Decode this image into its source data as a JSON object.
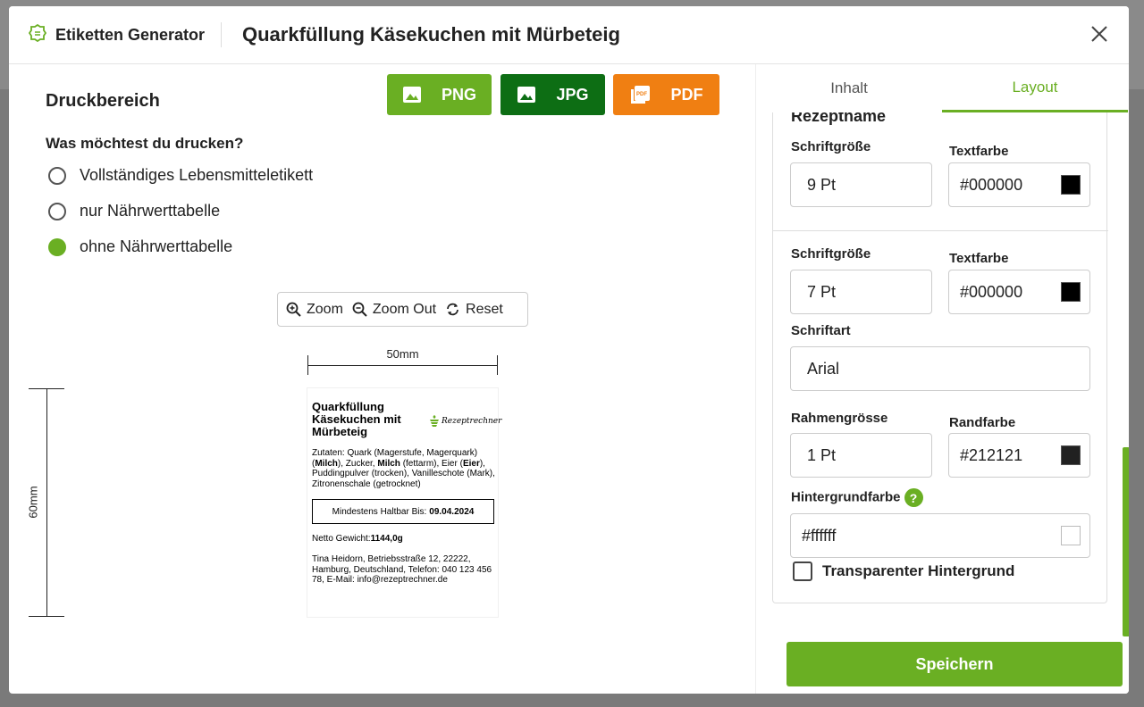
{
  "header": {
    "brand": "Etiketten Generator",
    "title": "Quarkfüllung Käsekuchen mit Mürbeteig"
  },
  "left": {
    "section_title": "Druckbereich",
    "export_buttons": {
      "png": "PNG",
      "jpg": "JPG",
      "pdf": "PDF"
    },
    "question": "Was möchtest du drucken?",
    "options": [
      {
        "label": "Vollständiges Lebensmitteletikett",
        "selected": false
      },
      {
        "label": "nur Nährwerttabelle",
        "selected": false
      },
      {
        "label": "ohne Nährwerttabelle",
        "selected": true
      }
    ],
    "zoom": {
      "zoom_in": "Zoom",
      "zoom_out": "Zoom Out",
      "reset": "Reset"
    },
    "dimensions": {
      "width": "50mm",
      "height": "60mm"
    }
  },
  "label": {
    "title": "Quarkfüllung Käsekuchen mit Mürbeteig",
    "logo_text": "Rezeptrechner",
    "ingredients_prefix": "Zutaten: Quark (Magerstufe, Magerquark) (",
    "allergen_milch_1": "Milch",
    "ingredients_mid1": "), Zucker, ",
    "allergen_milch_2": "Milch",
    "ingredients_mid2": " (fettarm), Eier (",
    "allergen_eier": "Eier",
    "ingredients_suffix": "), Puddingpulver (trocken), Vanilleschote (Mark), Zitronenschale (getrocknet)",
    "best_before_label": "Mindestens Haltbar Bis:",
    "best_before_date": "09.04.2024",
    "net_weight_label": "Netto Gewicht:",
    "net_weight_value": "1144,0g",
    "address": "Tina Heidorn, Betriebsstraße 12, 22222, Hamburg, Deutschland, Telefon: 040 123 456 78, E-Mail: info@rezeptrechner.de"
  },
  "right": {
    "tabs": {
      "inhalt": "Inhalt",
      "layout": "Layout"
    },
    "section_heading": "Rezeptname",
    "group1": {
      "size_label": "Schriftgröße",
      "size_value": "9 Pt",
      "color_label": "Textfarbe",
      "color_value": "#000000"
    },
    "group2": {
      "size_label": "Schriftgröße",
      "size_value": "7 Pt",
      "color_label": "Textfarbe",
      "color_value": "#000000",
      "font_label": "Schriftart",
      "font_value": "Arial",
      "border_size_label": "Rahmengrösse",
      "border_size_value": "1 Pt",
      "border_color_label": "Randfarbe",
      "border_color_value": "#212121",
      "bg_label": "Hintergrundfarbe",
      "bg_value": "#ffffff",
      "transparent_label": "Transparenter Hintergrund"
    },
    "save": "Speichern"
  },
  "colors": {
    "accent": "#6aaf23",
    "jpg": "#0d6e14",
    "pdf": "#f07f12"
  }
}
